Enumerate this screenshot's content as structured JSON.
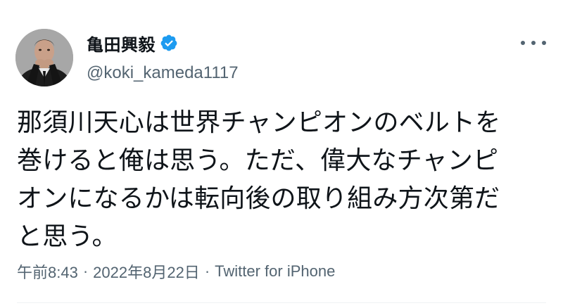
{
  "author": {
    "display_name": "亀田興毅",
    "handle": "@koki_kameda1117",
    "verified": true
  },
  "tweet": {
    "text": "那須川天心は世界チャンピオンのベルトを\n巻けると俺は思う。ただ、偉大なチャンピ\nオンになるかは転向後の取り組み方次第だ\nと思う。"
  },
  "meta": {
    "time": "午前8:43",
    "separator": "·",
    "date": "2022年8月22日",
    "source": "Twitter for iPhone"
  },
  "icons": {
    "verified": "verified-badge-icon",
    "more": "more-horizontal-icon"
  },
  "colors": {
    "verified_blue": "#1d9bf0",
    "secondary_text": "#536471",
    "primary_text": "#0f1419"
  }
}
